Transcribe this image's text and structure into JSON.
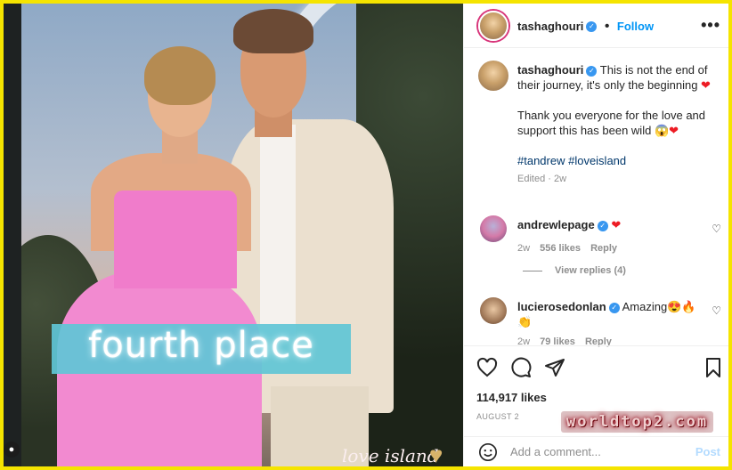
{
  "photo": {
    "caption_overlay": "fourth place",
    "brand": "love island"
  },
  "header": {
    "username": "tashaghouri",
    "follow": "Follow",
    "more": "•••"
  },
  "post": {
    "username": "tashaghouri",
    "line1": "This is not the end of their journey, it's only the beginning",
    "line2": "Thank you everyone for the love and support this has been wild",
    "hashtags": "#tandrew #loveisland",
    "meta": "Edited · 2w"
  },
  "comments": [
    {
      "username": "andrewlepage",
      "text": "",
      "age": "2w",
      "likes": "556 likes",
      "reply": "Reply"
    },
    {
      "username": "lucierosedonlan",
      "text": "Amazing",
      "age": "2w",
      "likes": "79 likes",
      "reply": "Reply"
    }
  ],
  "view_replies": "View replies (4)",
  "likes": "114,917 likes",
  "date": "AUGUST 2",
  "add_comment": {
    "placeholder": "Add a comment...",
    "post": "Post"
  },
  "watermark": "worldtop2.com",
  "icons": {
    "like": "heart-outline-icon",
    "comment": "comment-bubble-icon",
    "share": "paper-plane-icon",
    "save": "bookmark-icon",
    "emoji": "smiley-icon"
  },
  "colors": {
    "accent": "#0095f6",
    "verified": "#3897f0",
    "frame": "#f5e400",
    "overlay": "#5fc6d6"
  }
}
